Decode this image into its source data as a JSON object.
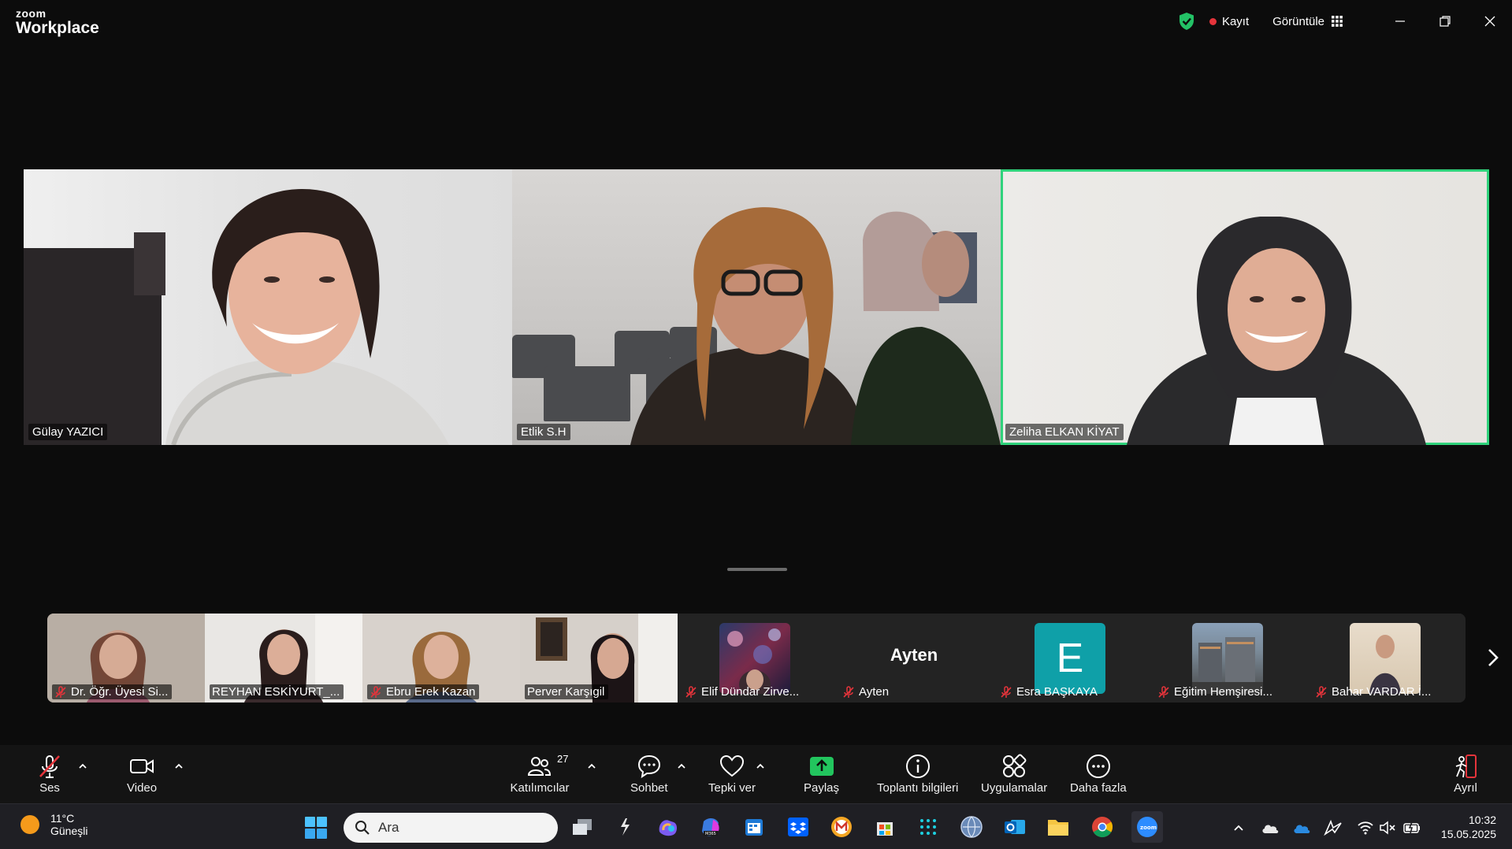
{
  "app": {
    "logo_small": "zoom",
    "logo_big": "Workplace"
  },
  "titlebar": {
    "record_label": "Kayıt",
    "view_label": "Görüntüle"
  },
  "main_tiles": [
    {
      "name": "Gülay YAZICI",
      "active": false
    },
    {
      "name": "Etlik S.H",
      "active": false
    },
    {
      "name": "Zeliha ELKAN KİYAT",
      "active": true
    }
  ],
  "strip": [
    {
      "name": "Dr. Öğr. Üyesi Si...",
      "muted": true
    },
    {
      "name": "REYHAN ESKİYURT_...",
      "muted": false
    },
    {
      "name": "Ebru Erek Kazan",
      "muted": true
    },
    {
      "name": "Perver Karşıgil",
      "muted": false
    },
    {
      "name": "Elif Dündar Zirve...",
      "muted": true
    },
    {
      "name": "Ayten",
      "muted": true,
      "avatar_text": "Ayten"
    },
    {
      "name": "Esra BAŞKAYA",
      "muted": true,
      "avatar_letter": "E"
    },
    {
      "name": "Eğitim Hemşiresi...",
      "muted": true
    },
    {
      "name": "Bahar VARDAR İ...",
      "muted": true
    }
  ],
  "toolbar": {
    "audio": "Ses",
    "video": "Video",
    "participants": "Katılımcılar",
    "participants_count": "27",
    "chat": "Sohbet",
    "react": "Tepki ver",
    "share": "Paylaş",
    "info": "Toplantı bilgileri",
    "apps": "Uygulamalar",
    "more": "Daha fazla",
    "leave": "Ayrıl"
  },
  "taskbar": {
    "weather_temp": "11°C",
    "weather_desc": "Güneşli",
    "search_placeholder": "Ara",
    "time": "10:32",
    "date": "15.05.2025"
  },
  "colors": {
    "active_border": "#2fd27b",
    "share": "#22c55e",
    "record": "#e5343b",
    "avatar_e": "#0fa0a8"
  }
}
